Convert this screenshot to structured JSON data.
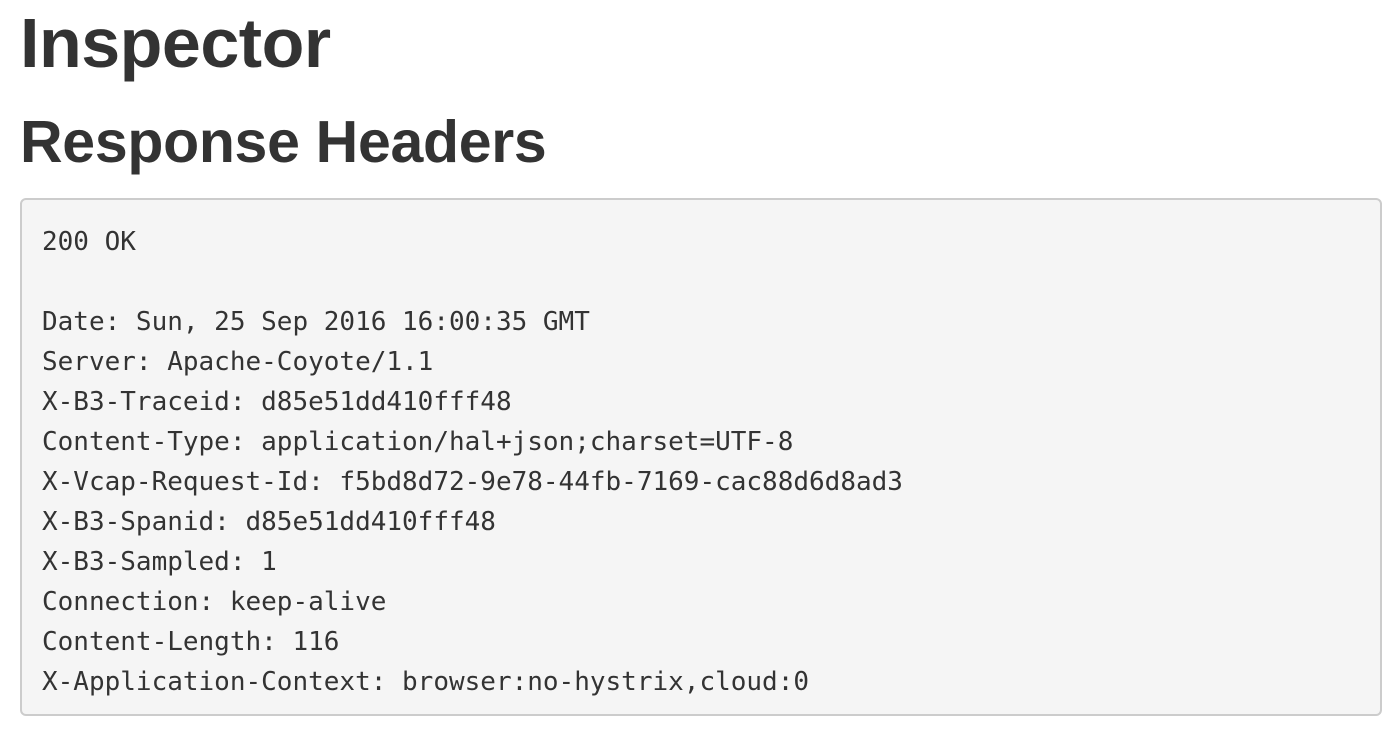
{
  "page": {
    "title": "Inspector",
    "subtitle": "Response Headers"
  },
  "response": {
    "status": "200 OK",
    "headers": [
      "Date: Sun, 25 Sep 2016 16:00:35 GMT",
      "Server: Apache-Coyote/1.1",
      "X-B3-Traceid: d85e51dd410fff48",
      "Content-Type: application/hal+json;charset=UTF-8",
      "X-Vcap-Request-Id: f5bd8d72-9e78-44fb-7169-cac88d6d8ad3",
      "X-B3-Spanid: d85e51dd410fff48",
      "X-B3-Sampled: 1",
      "Connection: keep-alive",
      "Content-Length: 116",
      "X-Application-Context: browser:no-hystrix,cloud:0"
    ]
  },
  "colors": {
    "text": "#333333",
    "box_background": "#f5f5f5",
    "box_border": "#cccccc"
  }
}
